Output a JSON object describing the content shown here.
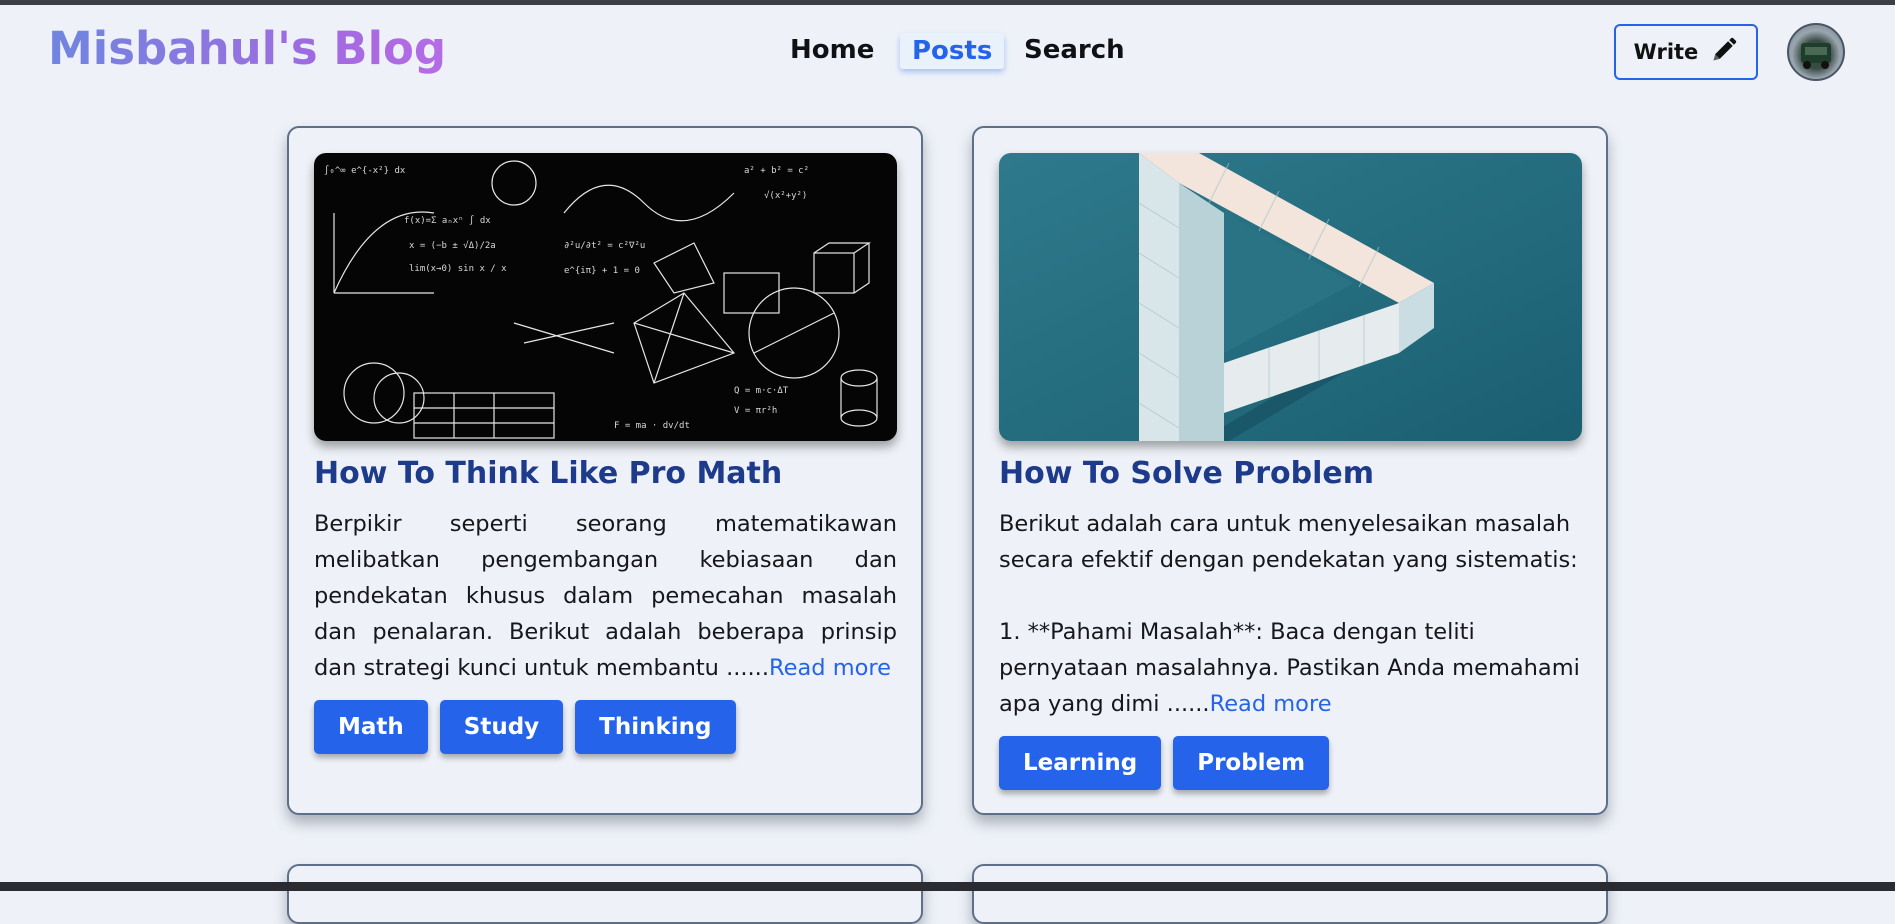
{
  "site": {
    "logo": "Misbahul's Blog"
  },
  "nav": {
    "home": "Home",
    "posts": "Posts",
    "search": "Search"
  },
  "header": {
    "write_label": "Write",
    "write_icon": "pencil-icon"
  },
  "colors": {
    "accent": "#2563eb",
    "title": "#1e3a8a",
    "background": "#eef2f8",
    "card_border": "#5e6f88"
  },
  "posts": [
    {
      "title": "How To Think Like Pro Math",
      "excerpt": "Berpikir seperti seorang matematikawan melibatkan pengembangan kebiasaan dan pendekatan khusus dalam pemecahan masalah dan penalaran. Berikut adalah beberapa prinsip dan strategi kunci untuk membantu ......",
      "read_more": "Read more",
      "tags": [
        "Math",
        "Study",
        "Thinking"
      ]
    },
    {
      "title": "How To Solve Problem",
      "excerpt": "Berikut adalah cara untuk menyelesaikan masalah secara efektif dengan pendekatan yang sistematis:\n\n1. **Pahami Masalah**: Baca dengan teliti pernyataan masalahnya. Pastikan Anda memahami apa yang dimi ......",
      "read_more": "Read more",
      "tags": [
        "Learning",
        "Problem"
      ]
    }
  ]
}
